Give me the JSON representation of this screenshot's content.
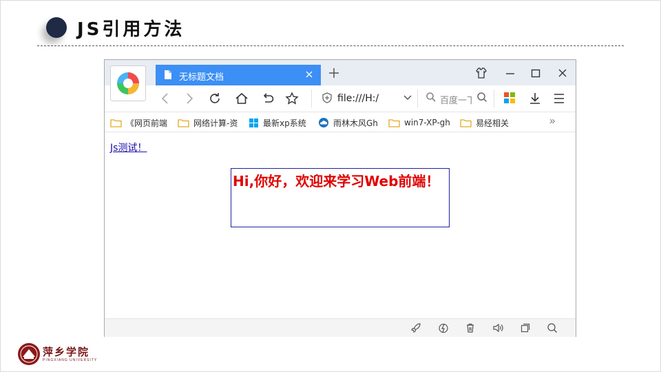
{
  "slide": {
    "title": "JS引用方法"
  },
  "browser": {
    "tab_title": "无标题文档",
    "new_tab_symbol": "+",
    "address": "file:///H:/",
    "search_placeholder": "百度一下",
    "bookmarks": [
      {
        "label": "《网页前端",
        "icon": "folder-icon"
      },
      {
        "label": "网络计算-资",
        "icon": "folder-icon"
      },
      {
        "label": "最新xp系统",
        "icon": "windows-icon"
      },
      {
        "label": "雨林木风Gh",
        "icon": "cloud-icon"
      },
      {
        "label": "win7-XP-gh",
        "icon": "folder-icon"
      },
      {
        "label": "易经相关",
        "icon": "folder-icon"
      }
    ],
    "bookmarks_more": "»"
  },
  "page": {
    "link_text": "Js测试！",
    "hello_text": "Hi,你好，欢迎来学习Web前端！"
  },
  "footer": {
    "school_name": "萍乡学院",
    "school_subtitle": "PINGXIANG UNIVERSITY"
  },
  "colors": {
    "tab_active": "#3c8ff5",
    "hello_text": "#e00000",
    "hello_border": "#2020a0",
    "link": "#1a0dab",
    "title_dot": "#1f2a44",
    "school": "#7a1616"
  }
}
